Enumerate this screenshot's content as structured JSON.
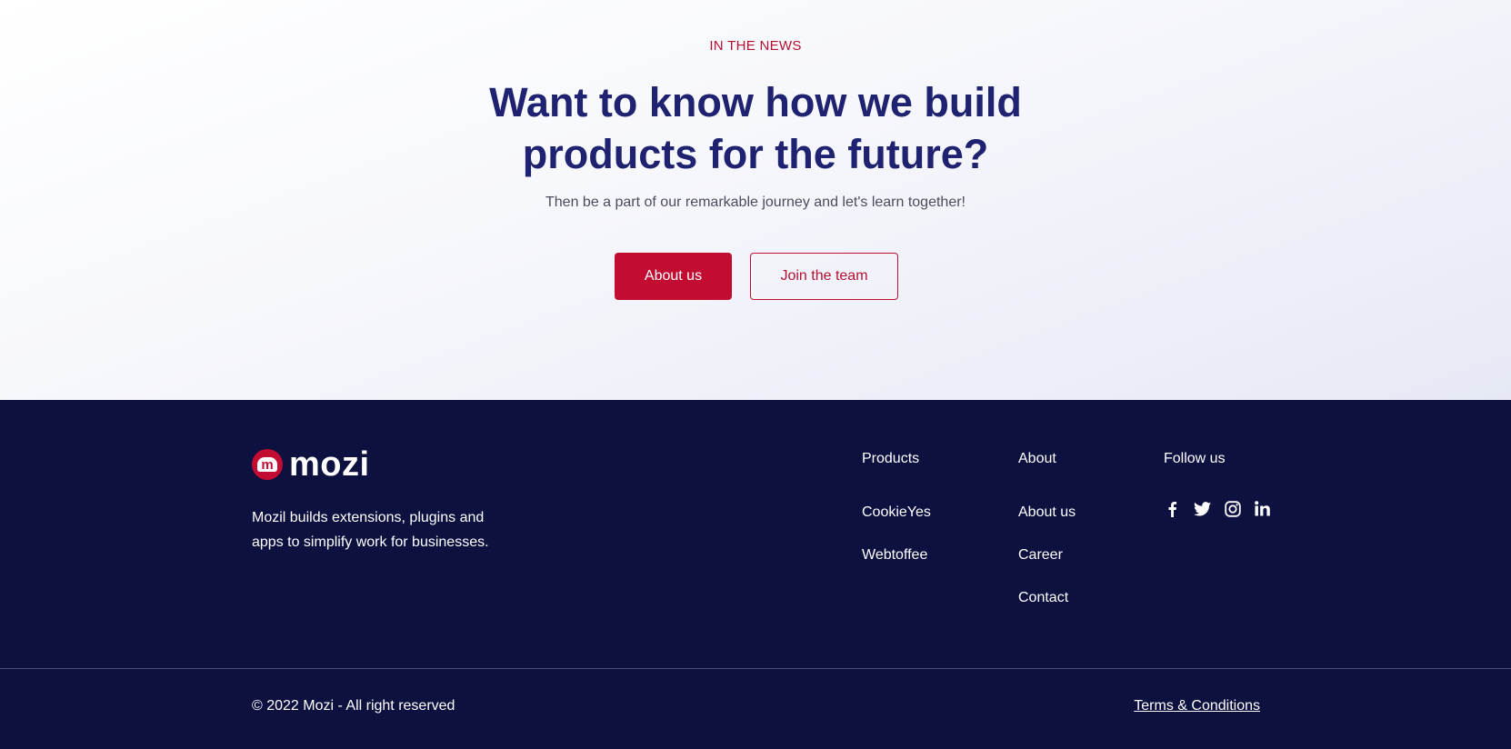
{
  "hero": {
    "eyebrow": "IN THE NEWS",
    "headline_line1": "Want to know how we build",
    "headline_line2": "products for the future?",
    "subtext": "Then be a part of our remarkable journey and let's learn together!",
    "primary_button": "About us",
    "secondary_button": "Join the team"
  },
  "footer": {
    "logo_letter": "m",
    "logo_text": "mozi",
    "description": "Mozil builds extensions, plugins and apps to simplify work for businesses.",
    "columns": [
      {
        "heading": "Products",
        "links": [
          "CookieYes",
          "Webtoffee"
        ]
      },
      {
        "heading": "About",
        "links": [
          "About us",
          "Career",
          "Contact"
        ]
      }
    ],
    "follow_heading": "Follow us",
    "social_icons": [
      "facebook-icon",
      "twitter-icon",
      "instagram-icon",
      "linkedin-icon"
    ],
    "copyright": "© 2022 Mozi - All right reserved",
    "terms": "Terms & Conditions"
  },
  "colors": {
    "accent": "#c20c31",
    "headline": "#1e2270",
    "footer_bg": "#0c1140"
  }
}
